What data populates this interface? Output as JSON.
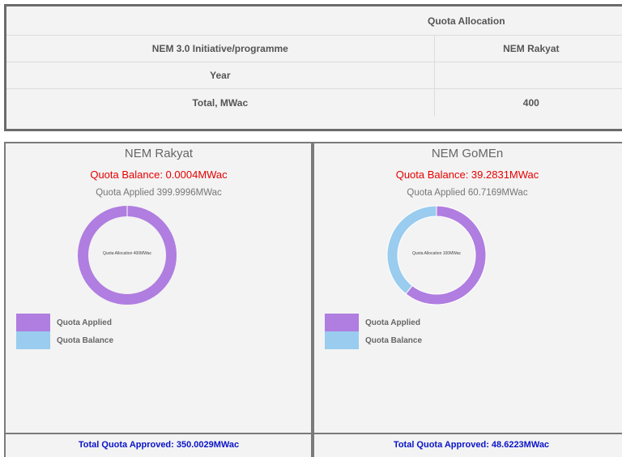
{
  "quota_table": {
    "header": "Quota Allocation",
    "rows": [
      {
        "label": "NEM 3.0 Initiative/programme",
        "value": "NEM Rakyat"
      },
      {
        "label": "Year",
        "value": ""
      },
      {
        "label": "Total, MWac",
        "value": "400"
      }
    ]
  },
  "panels": [
    {
      "title": "NEM Rakyat",
      "balance": "Quota Balance: 0.0004MWac",
      "applied": "Quota Applied 399.9996MWac",
      "donut_label": "Quota Allocation 400MWac",
      "footer": "Total Quota Approved: 350.0029MWac"
    },
    {
      "title": "NEM GoMEn",
      "balance": "Quota Balance: 39.2831MWac",
      "applied": "Quota Applied 60.7169MWac",
      "donut_label": "Quota Allocation 100MWac",
      "footer": "Total Quota Approved: 48.6223MWac"
    }
  ],
  "legend": {
    "applied": "Quota Applied",
    "balance": "Quota Balance"
  },
  "colors": {
    "applied": "#b07de0",
    "balance": "#99ccee",
    "balance_text": "#e60000",
    "footer_text": "#0a14c8"
  },
  "chart_data": [
    {
      "type": "pie",
      "categories": [
        "Quota Applied",
        "Quota Balance"
      ],
      "values": [
        399.9996,
        0.0004
      ]
    },
    {
      "type": "pie",
      "categories": [
        "Quota Applied",
        "Quota Balance"
      ],
      "values": [
        60.7169,
        39.2831
      ]
    }
  ]
}
